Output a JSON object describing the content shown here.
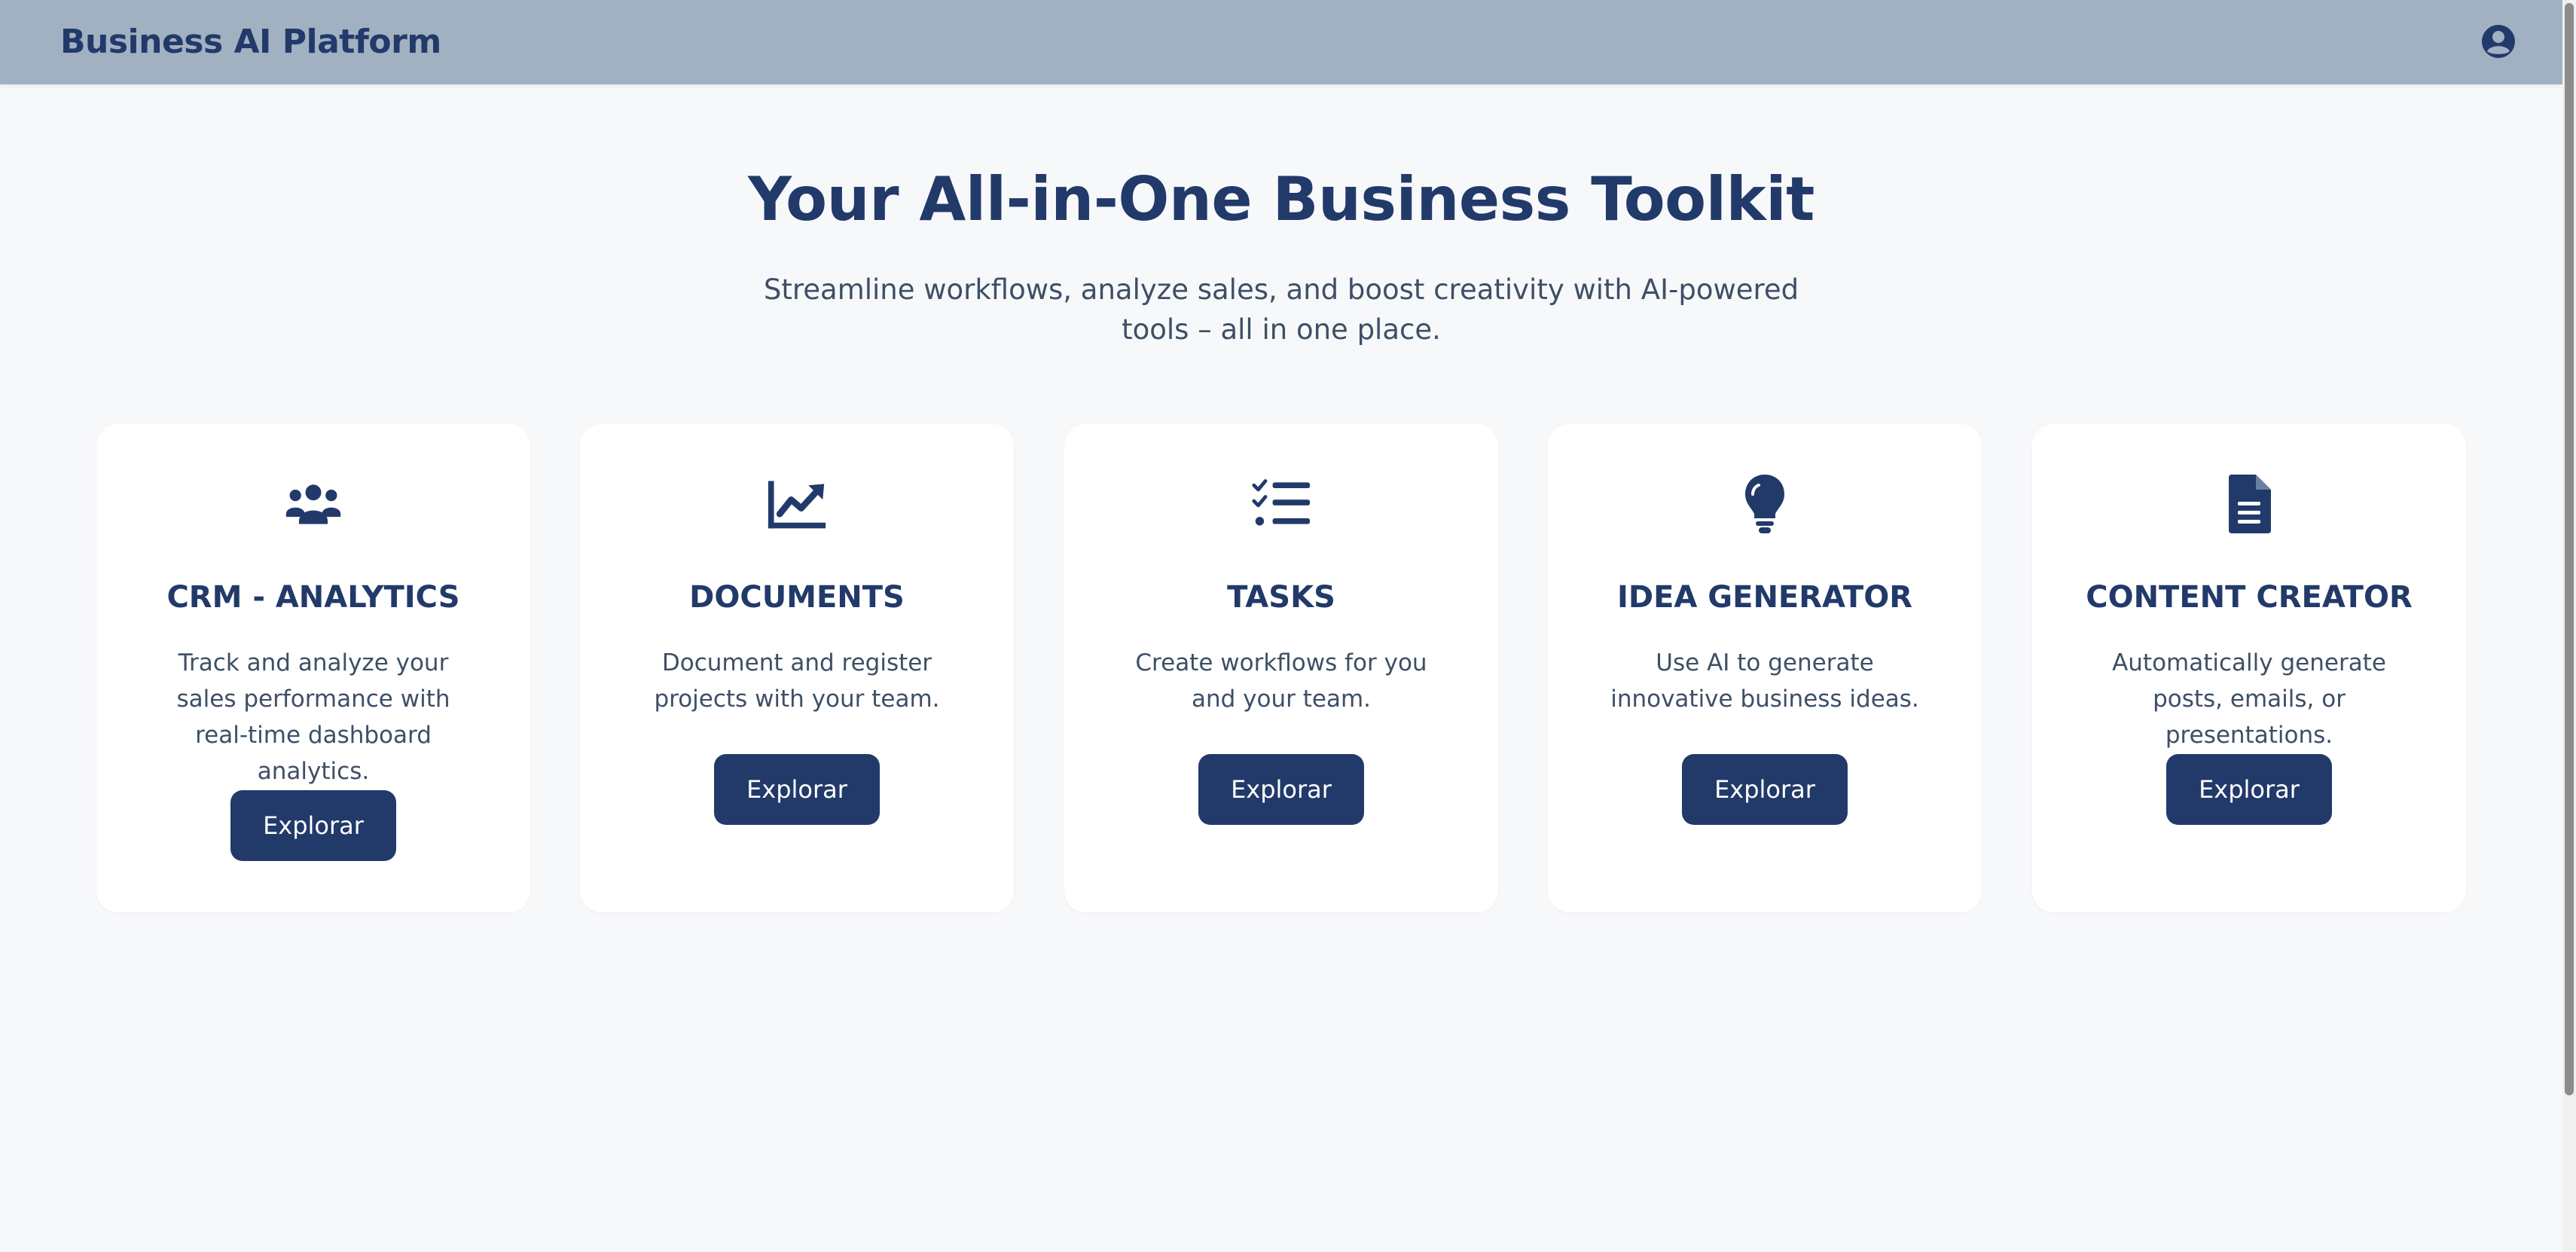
{
  "header": {
    "brand": "Business AI Platform",
    "user_icon": "user-circle-icon"
  },
  "hero": {
    "title": "Your All-in-One Business Toolkit",
    "subtitle": "Streamline workflows, analyze sales, and boost creativity with AI-powered tools – all in one place."
  },
  "cards": [
    {
      "icon": "users-icon",
      "title": "CRM - ANALYTICS",
      "description": "Track and analyze your sales performance with real-time dashboard analytics.",
      "button": "Explorar"
    },
    {
      "icon": "chart-line-icon",
      "title": "DOCUMENTS",
      "description": "Document and register projects with your team.",
      "button": "Explorar"
    },
    {
      "icon": "task-list-icon",
      "title": "TASKS",
      "description": "Create workflows for you and your team.",
      "button": "Explorar"
    },
    {
      "icon": "lightbulb-icon",
      "title": "IDEA GENERATOR",
      "description": "Use AI to generate innovative business ideas.",
      "button": "Explorar"
    },
    {
      "icon": "document-icon",
      "title": "CONTENT CREATOR",
      "description": "Automatically generate posts, emails, or presentations.",
      "button": "Explorar"
    }
  ],
  "colors": {
    "primary": "#223a6a",
    "header_bg": "#a1b1c2",
    "page_bg": "#f7f8fa",
    "card_bg": "#ffffff",
    "body_text": "#3e4f66"
  }
}
